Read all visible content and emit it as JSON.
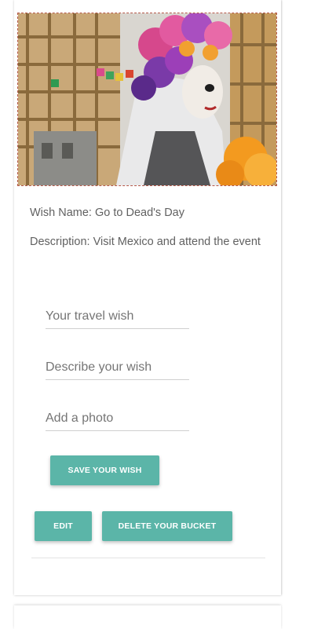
{
  "wish_card": {
    "photo_alt": "Person in Day of the Dead makeup with flower crown",
    "wish_name": "Wish Name: Go to Dead's Day",
    "description": "Description: Visit Mexico and attend the event"
  },
  "form": {
    "travel_wish_placeholder": "Your travel wish",
    "describe_placeholder": "Describe your wish",
    "photo_placeholder": "Add a photo",
    "save_label": "SAVE YOUR WISH"
  },
  "actions": {
    "edit_label": "EDIT",
    "delete_label": "DELETE YOUR BUCKET"
  },
  "colors": {
    "accent": "#5bb5a8",
    "text": "#616161"
  }
}
